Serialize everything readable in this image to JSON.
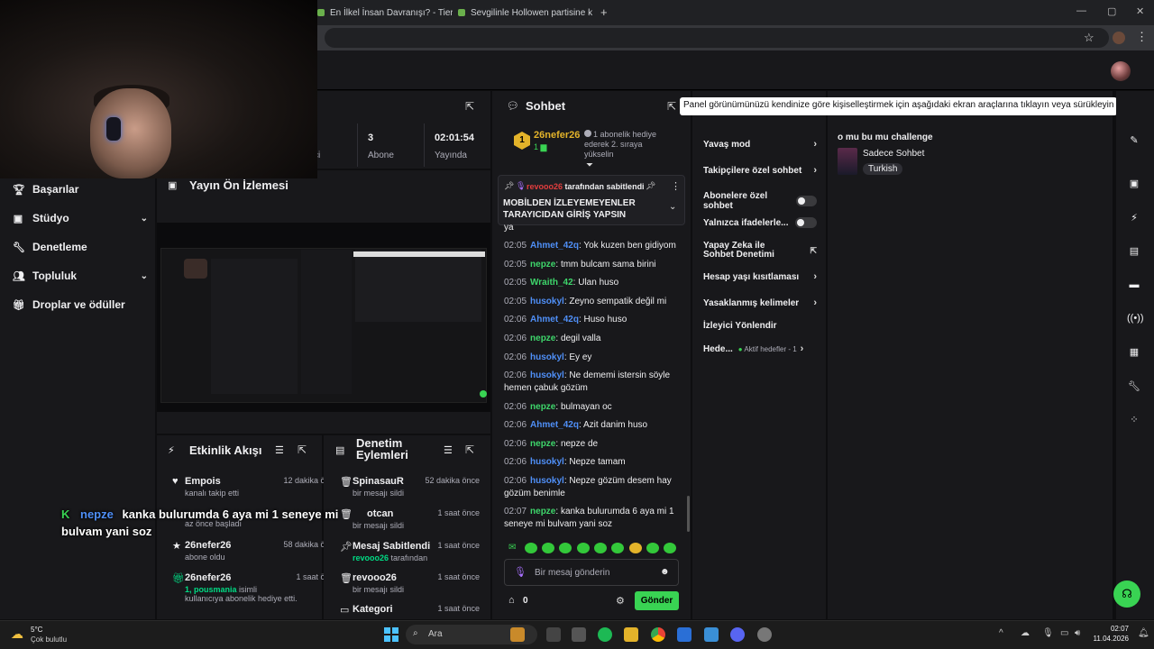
{
  "browser": {
    "tabs": [
      {
        "label": "En İlkel İnsan Davranışı? - Tier L"
      },
      {
        "label": "Sevgilinle Hollowen partisine k"
      }
    ],
    "new_tab": "+",
    "win_min": "—",
    "win_max": "▢",
    "win_close": "✕"
  },
  "sidebar": {
    "items": [
      {
        "label": "Başarılar",
        "icon": "trophy-icon"
      },
      {
        "label": "Stüdyo",
        "icon": "studio-icon"
      },
      {
        "label": "Denetleme",
        "icon": "wrench-icon"
      },
      {
        "label": "Topluluk",
        "icon": "community-icon"
      },
      {
        "label": "Droplar ve ödüller",
        "icon": "gift-icon"
      }
    ]
  },
  "stats": {
    "cell1": {
      "value": "",
      "label": "çi"
    },
    "cell2": {
      "value": "3",
      "label": "Abone"
    },
    "cell3": {
      "value": "02:01:54",
      "label": "Yayında"
    }
  },
  "preview": {
    "title": "Yayın Ön İzlemesi"
  },
  "activity": {
    "title": "Etkinlik Akışı",
    "items": [
      {
        "name": "Empois",
        "time": "12 dakika önce",
        "sub": "kanalı takip etti"
      },
      {
        "name": "",
        "time": "",
        "sub": "az önce başladı"
      },
      {
        "name": "26nefer26",
        "time": "58 dakika önce",
        "sub": "abone oldu"
      },
      {
        "name": "26nefer26",
        "time": "1 saat önce",
        "sub_highlight": "1, pousmania",
        "sub": "isimli kullanıcıya abonelik hediye etti."
      }
    ]
  },
  "modlog": {
    "title": "Denetim Eylemleri",
    "items": [
      {
        "name": "SpinasauR",
        "time": "52 dakika önce",
        "sub": "bir mesajı sildi"
      },
      {
        "name": "otcan",
        "time": "1 saat önce",
        "sub": "bir mesajı sildi"
      },
      {
        "name": "Mesaj Sabitlendi",
        "time": "1 saat önce",
        "sub_highlight": "revooo26",
        "sub": "tarafından"
      },
      {
        "name": "revooo26",
        "time": "1 saat önce",
        "sub": "bir mesajı sildi"
      },
      {
        "name": "Kategori",
        "time": "1 saat önce",
        "sub": ""
      }
    ]
  },
  "chat": {
    "title": "Sohbet",
    "gifter": {
      "rank": "1",
      "name": "26nefer26",
      "count": "1",
      "text": "1 abonelik hediye ederek 2. sıraya yükselin"
    },
    "pinned": {
      "by": "revooo26",
      "by_suffix": "tarafından sabitlendi",
      "text": "MOBİLDEN İZLEYEMEYENLER TARAYICIDAN GİRİŞ YAPSIN"
    },
    "partial_line": "ya",
    "messages": [
      {
        "time": "02:05",
        "user": "Ahmet_42q",
        "color": "blue",
        "text": "Yok kuzen ben gidiyom"
      },
      {
        "time": "02:05",
        "user": "nepze",
        "color": "green",
        "text": "tmm bulcam sama birini"
      },
      {
        "time": "02:05",
        "user": "Wraith_42",
        "color": "green",
        "text": "Ulan huso"
      },
      {
        "time": "02:05",
        "user": "husokyl",
        "color": "blue",
        "text": "Zeyno sempatik değil mi"
      },
      {
        "time": "02:06",
        "user": "Ahmet_42q",
        "color": "blue",
        "text": "Huso huso"
      },
      {
        "time": "02:06",
        "user": "nepze",
        "color": "green",
        "text": "degil valla"
      },
      {
        "time": "02:06",
        "user": "husokyl",
        "color": "blue",
        "text": "Ey ey"
      },
      {
        "time": "02:06",
        "user": "husokyl",
        "color": "blue",
        "text": "Ne dememi istersin söyle hemen çabuk gözüm"
      },
      {
        "time": "02:06",
        "user": "nepze",
        "color": "green",
        "text": "bulmayan oc"
      },
      {
        "time": "02:06",
        "user": "Ahmet_42q",
        "color": "blue",
        "text": "Azit danim huso"
      },
      {
        "time": "02:06",
        "user": "nepze",
        "color": "green",
        "text": "nepze de"
      },
      {
        "time": "02:06",
        "user": "husokyl",
        "color": "blue",
        "text": "Nepze tamam"
      },
      {
        "time": "02:06",
        "user": "husokyl",
        "color": "blue",
        "text": "Nepze gözüm desem hay gözüm benimle"
      },
      {
        "time": "02:07",
        "user": "nepze",
        "color": "green",
        "text": "kanka bulurumda 6 aya mi 1 seneye mi bulvam yani soz"
      }
    ],
    "input_placeholder": "Bir mesaj gönderin",
    "points": "0",
    "send_label": "Gönder"
  },
  "modtools": {
    "items": [
      {
        "label": "Yavaş mod",
        "control": "arrow"
      },
      {
        "label": "Takipçilere özel sohbet",
        "control": "arrow"
      },
      {
        "label": "Abonelere özel sohbet",
        "control": "toggle"
      },
      {
        "label": "Yalnızca ifadelerle...",
        "control": "toggle"
      },
      {
        "label": "Yapay Zeka ile Sohbet Denetimi",
        "control": "external"
      },
      {
        "label": "Hesap yaşı kısıtlaması",
        "control": "arrow"
      },
      {
        "label": "Yasaklanmış kelimeler",
        "control": "arrow"
      },
      {
        "label": "İzleyici Yönlendir",
        "control": "none"
      },
      {
        "label": "Hede...",
        "control": "arrow",
        "extra": "Aktif hedefler - 1"
      }
    ]
  },
  "tooltip": "Panel görünümünüzü kendinize göre kişiselleştirmek için aşağıdaki ekran araçlarına tıklayın veya sürükleyin",
  "rightpanel": {
    "title": "o mu bu mu challenge",
    "category": "Sadece Sohbet",
    "tag": "Turkish"
  },
  "overlay": {
    "user": "nepze",
    "text": "kanka bulurumda 6 aya mi 1 seneye mi bulvam yani soz"
  },
  "taskbar": {
    "weather_temp": "5°C",
    "weather_desc": "Çok bulutlu",
    "search_placeholder": "Ara",
    "time": "02:07",
    "date": "11.04.2026"
  },
  "colors": {
    "accent_green": "#39d353",
    "twitch_purple": "#9147ff",
    "username_blue": "#4f8ff7"
  }
}
